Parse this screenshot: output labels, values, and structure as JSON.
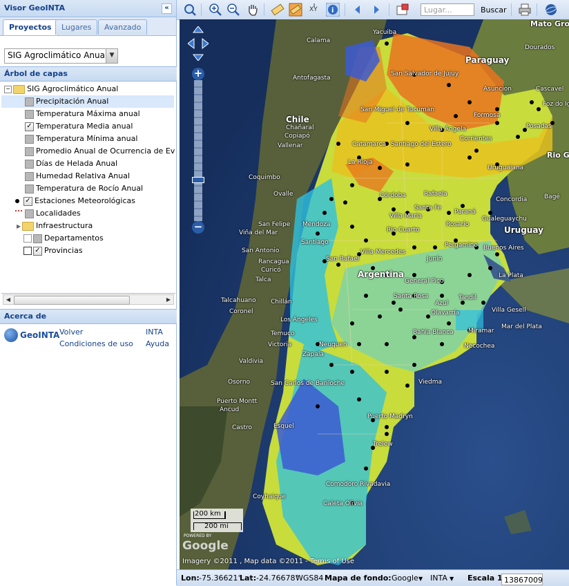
{
  "app": {
    "title": "Visor GeoINTA",
    "collapse_symbol": "«"
  },
  "tabs": [
    "Proyectos",
    "Lugares",
    "Avanzado"
  ],
  "project_select": {
    "value": "SIG Agroclimático Anual"
  },
  "layers": {
    "header": "Árbol de capas",
    "root": "SIG Agroclimático Anual",
    "items": [
      {
        "label": "Precipitación Anual",
        "checked": false
      },
      {
        "label": "Temperatura Máxima anual",
        "checked": false
      },
      {
        "label": "Temperatura Media anual",
        "checked": true
      },
      {
        "label": "Temperatura Mínima anual",
        "checked": false
      },
      {
        "label": "Promedio Anual de Ocurrencia de Eventos",
        "checked": false
      },
      {
        "label": "Días de Helada Anual",
        "checked": false
      },
      {
        "label": "Humedad Relativa Anual",
        "checked": false
      },
      {
        "label": "Temperatura de Rocío Anual",
        "checked": false
      },
      {
        "label": "Estaciones Meteorológicas",
        "checked": true
      },
      {
        "label": "Localidades",
        "checked": false
      }
    ],
    "folder": "Infraestructura",
    "extra": [
      {
        "label": "Departamentos",
        "checked": false
      },
      {
        "label": "Provincias",
        "checked": true
      }
    ]
  },
  "about": {
    "header": "Acerca de",
    "logo": "GeoINTA",
    "links": [
      "Volver",
      "INTA",
      "Condiciones de uso",
      "Ayuda"
    ]
  },
  "toolbar": {
    "search_placeholder": "Lugar...",
    "search_button": "Buscar"
  },
  "map": {
    "scale_km": "200 km",
    "scale_mi": "200 mi",
    "powered_by": "POWERED BY",
    "google": "Google",
    "attribution": "Imagery ©2011 , Map data ©2011 - Terms of Use",
    "labels": {
      "countries": [
        "Chile",
        "Argentina",
        "Paraguay",
        "Uruguay",
        "Mato Grosso do Sul",
        "Rio Grande do Sul"
      ],
      "places": [
        "Yacuiba",
        "Calama",
        "Dourados",
        "Antofagasta",
        "San Salvador de Jujuy",
        "Asuncion",
        "Cascavel",
        "San Miguel de Tucuman",
        "Formosa",
        "Foz do Iguaçu",
        "Chañaral",
        "Copiapó",
        "Vallenar",
        "Catamarca",
        "Santiago del Estero",
        "Villa Ángela",
        "Posadas",
        "Corrientes",
        "La Rioja",
        "Coquimbo",
        "Ovalle",
        "Uruguaiana",
        "Córdoba",
        "Rafaela",
        "Bagé",
        "Villa Maria",
        "San Felipe",
        "Viña del Mar",
        "Mendoza",
        "Santiago",
        "San Antonio",
        "Rancagua",
        "Talca",
        "San Rafael",
        "Rio Cuarto",
        "Rosario",
        "Pergamino",
        "Buenos Aires",
        "La Plata",
        "Villa Mercedes",
        "Curicó",
        "Talcahuano",
        "Coronel",
        "Chillán",
        "Los Ángeles",
        "Temuco",
        "Valdivia",
        "Osorno",
        "Puerto Montt",
        "Ancud",
        "Castro",
        "Santa Rosa",
        "General Pico",
        "Tandil",
        "Mar del Plata",
        "Bahía Blanca",
        "Necochea",
        "Neuquen",
        "Zapala",
        "Viedma",
        "San Carlos de Bariloche",
        "Esquel",
        "Puerto Madryn",
        "Trelew",
        "Comodoro Rivadavia",
        "Caleta Olivia",
        "Coyhaique",
        "Concordia",
        "Gualeguaychu",
        "Victoria",
        "Santa Fe",
        "Paraná",
        "Junín",
        "Azul",
        "Olavarría",
        "Villa Gesell",
        "Miramar"
      ]
    }
  },
  "status": {
    "lon_label": "Lon:",
    "lon_value": "-75.36621°",
    "lat_label": "Lat:",
    "lat_value": "-24.76678°",
    "datum": "WGS84",
    "base_label": "Mapa de fondo:",
    "base1": "Google",
    "base2": "INTA",
    "scale_label": "Escala 1:",
    "scale_value": "13867009"
  },
  "colors": {
    "panel_header": "#15428b",
    "accent": "#99bbe8",
    "ocean": "#1c3a6e",
    "zone_hot": "#e8731e",
    "zone_warm": "#e8c21e",
    "zone_mild": "#c8dc3c",
    "zone_cool": "#78d2b4",
    "zone_cold": "#2ec0e0",
    "zone_coldest": "#3c5ad2"
  }
}
